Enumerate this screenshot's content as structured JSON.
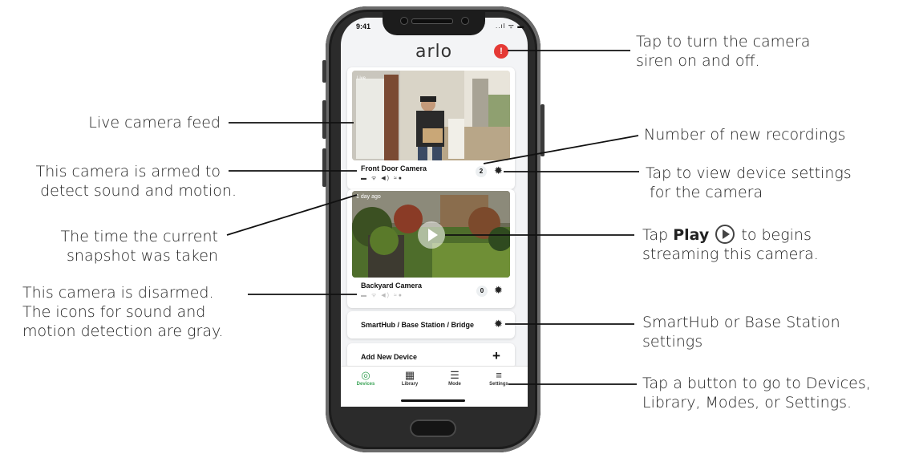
{
  "callouts": {
    "left": {
      "live_feed": "Live camera feed",
      "armed_1": "This camera is armed to",
      "armed_2": "detect sound and motion.",
      "snapshot_1": "The time the current",
      "snapshot_2": "snapshot was taken",
      "disarmed_1": "This camera is disarmed.",
      "disarmed_2": "The icons for sound and",
      "disarmed_3": "motion detection are gray."
    },
    "right": {
      "siren_1": "Tap to turn the camera",
      "siren_2": "siren on and off.",
      "new_recordings": "Number of new recordings",
      "settings_1": "Tap to view device settings",
      "settings_2": "for the camera",
      "play_prefix": "Tap ",
      "play_bold": "Play",
      "play_suffix": " to begins",
      "play_2": "streaming this camera.",
      "hub_1": "SmartHub or Base Station",
      "hub_2": "settings",
      "nav_1": "Tap a button to go to Devices,",
      "nav_2": "Library, Modes, or Settings."
    }
  },
  "phone": {
    "status_time": "9:41",
    "status_icons": "..ıl ᯤ ▬",
    "app_title": "arlo",
    "siren_icon": "siren-icon",
    "cards": [
      {
        "name": "Front Door Camera",
        "count": "2",
        "time": "Live",
        "armed": true
      },
      {
        "name": "Backyard Camera",
        "count": "0",
        "time": "1 day ago",
        "armed": false
      }
    ],
    "hub_row": "SmartHub / Base Station / Bridge",
    "add_row": "Add New Device",
    "add_icon": "+",
    "nav": [
      {
        "label": "Devices",
        "icon": "◎"
      },
      {
        "label": "Library",
        "icon": "▦"
      },
      {
        "label": "Mode",
        "icon": "☰"
      },
      {
        "label": "Settings",
        "icon": "≡"
      }
    ]
  },
  "colors": {
    "accent": "#3aa356",
    "siren": "#e53935"
  }
}
